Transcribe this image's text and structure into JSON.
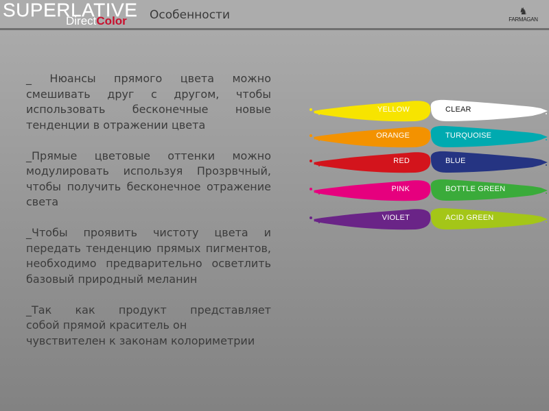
{
  "header": {
    "logo_main": "SUPERLATIVE",
    "logo_sub_prefix": "Direct",
    "logo_sub_accent": "Color",
    "title": "Особенности",
    "brand": "FARMAGAN",
    "accent_color": "#c8102e"
  },
  "paragraphs": [
    {
      "text": "_ Нюансы прямого цвета можно смешивать друг с другом, чтобы использовать бесконечные новые тенденции в отражении цвета"
    },
    {
      "text": "_Прямые цветовые оттенки можно модулировать используя Прозрвчный, чтобы получить бесконечное отражение света"
    },
    {
      "text": "_Чтобы проявить чистоту цвета и передать тенденцию прямых пигментов, необходимо предварительно осветлить базовый природный меланин"
    },
    {
      "line1": "_Так как продукт представляет",
      "line2": "собой прямой краситель он",
      "line3": "чувствителен к законам колориметрии"
    }
  ],
  "swatches": [
    {
      "left": {
        "label": "YELLOW",
        "color": "#f7e400",
        "text_color": "#ffffff"
      },
      "right": {
        "label": "CLEAR",
        "color": "#ffffff",
        "text_color": "#111111"
      }
    },
    {
      "left": {
        "label": "ORANGE",
        "color": "#f39200",
        "text_color": "#ffffff"
      },
      "right": {
        "label": "TURQUOISE",
        "color": "#00aab0",
        "text_color": "#ffffff"
      }
    },
    {
      "left": {
        "label": "RED",
        "color": "#d3141c",
        "text_color": "#ffffff"
      },
      "right": {
        "label": "BLUE",
        "color": "#253482",
        "text_color": "#ffffff"
      }
    },
    {
      "left": {
        "label": "PINK",
        "color": "#e6007e",
        "text_color": "#ffffff"
      },
      "right": {
        "label": "BOTTLE GREEN",
        "color": "#3aab3a",
        "text_color": "#ffffff"
      }
    },
    {
      "left": {
        "label": "VIOLET",
        "color": "#6a2487",
        "text_color": "#ffffff"
      },
      "right": {
        "label": "ACID GREEN",
        "color": "#a4c618",
        "text_color": "#ffffff"
      }
    }
  ]
}
